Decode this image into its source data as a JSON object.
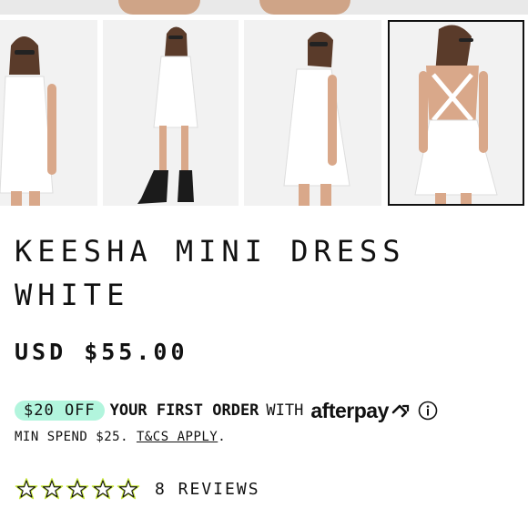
{
  "gallery": {
    "thumbnails": [
      {
        "name": "front-view",
        "selected": false
      },
      {
        "name": "full-length-boots",
        "selected": false
      },
      {
        "name": "side-view",
        "selected": false
      },
      {
        "name": "back-view",
        "selected": true
      }
    ]
  },
  "product": {
    "title": "KEESHA MINI DRESS WHITE",
    "price": "USD $55.00"
  },
  "promo": {
    "badge": "$20 OFF",
    "bold_text": "YOUR FIRST ORDER",
    "with_text": "WITH",
    "brand": "afterpay",
    "min_spend_text": "MIN SPEND $25.",
    "tcs_link": "T&CS APPLY",
    "period": "."
  },
  "reviews": {
    "stars": 5,
    "filled_stars": 0,
    "count_label": "8 REVIEWS",
    "star_color": "#c8e63c"
  },
  "colors": {
    "promo_badge": "#b2f5dd",
    "text": "#111111"
  }
}
